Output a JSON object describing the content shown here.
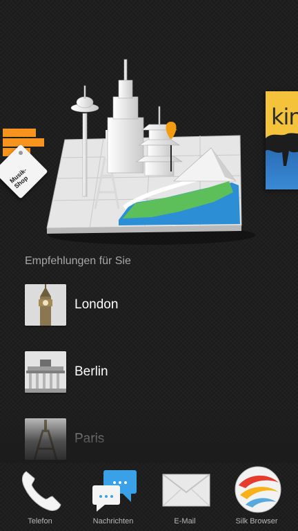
{
  "carousel": {
    "left_card": {
      "tag_label": "Musik-Shop",
      "accent": "#f7941d"
    },
    "main_card": {
      "icon": "maps-3d-city-icon"
    },
    "right_card": {
      "title_fragment": "kin"
    }
  },
  "recommendations": {
    "heading": "Empfehlungen für Sie",
    "items": [
      {
        "label": "London",
        "icon": "big-ben-thumbnail"
      },
      {
        "label": "Berlin",
        "icon": "brandenburg-gate-thumbnail"
      },
      {
        "label": "Paris",
        "icon": "eiffel-tower-thumbnail"
      }
    ]
  },
  "dock": {
    "items": [
      {
        "label": "Telefon",
        "icon": "phone-icon"
      },
      {
        "label": "Nachrichten",
        "icon": "messages-icon"
      },
      {
        "label": "E-Mail",
        "icon": "email-icon"
      },
      {
        "label": "Silk Browser",
        "icon": "silk-browser-icon"
      }
    ]
  }
}
